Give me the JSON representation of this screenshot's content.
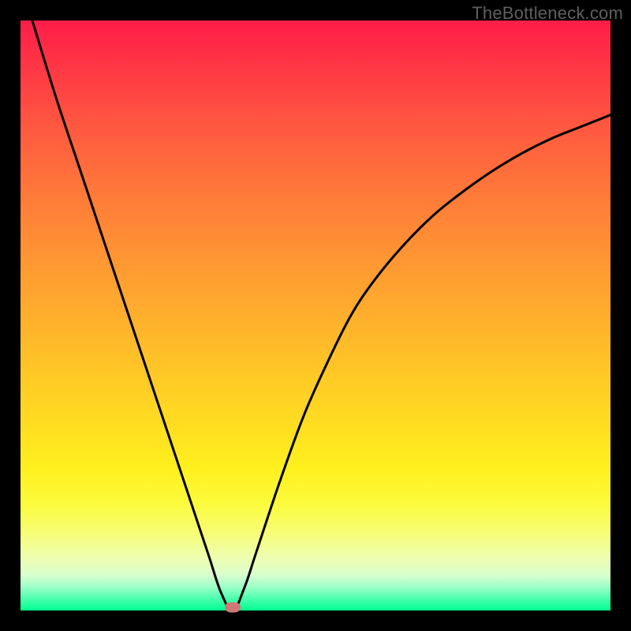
{
  "watermark": "TheBottleneck.com",
  "colors": {
    "frame": "#000000",
    "gradient_top": "#ff1d49",
    "gradient_bottom": "#00ff8e",
    "curve": "#000000",
    "marker": "#cf7976"
  },
  "chart_data": {
    "type": "line",
    "title": "",
    "xlabel": "",
    "ylabel": "",
    "xlim": [
      0,
      100
    ],
    "ylim": [
      0,
      100
    ],
    "series": [
      {
        "name": "bottleneck-curve",
        "x": [
          2,
          6,
          10,
          14,
          18,
          22,
          26,
          30,
          32,
          34,
          36,
          38,
          40,
          44,
          48,
          52,
          56,
          60,
          65,
          70,
          75,
          80,
          85,
          90,
          95,
          100
        ],
        "values": [
          100,
          87,
          75,
          63,
          51,
          39,
          27,
          15,
          9,
          3,
          0,
          4,
          10,
          22,
          33,
          42,
          50,
          56,
          62,
          67,
          71,
          74.5,
          77.5,
          80,
          82,
          84
        ]
      }
    ],
    "annotations": [
      {
        "name": "optimal-marker",
        "x": 36,
        "y": 0.5
      }
    ]
  }
}
